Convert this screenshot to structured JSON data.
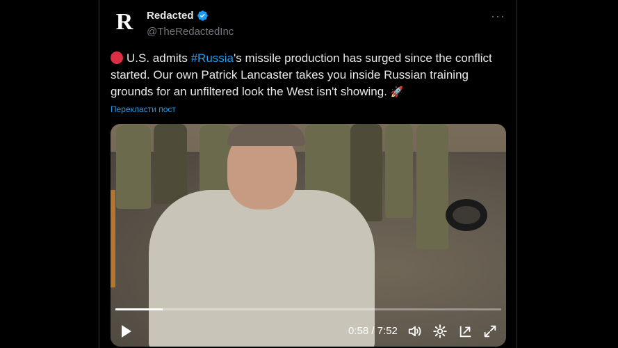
{
  "account": {
    "avatar_letter": "R",
    "display_name": "Redacted",
    "handle": "@TheRedactedInc",
    "verified_color": "#1d9bf0"
  },
  "tweet": {
    "text_before_hashtag": "U.S. admits ",
    "hashtag": "#Russia",
    "text_after_hashtag": "'s missile production has surged since the conflict started. Our own Patrick Lancaster takes you inside Russian training grounds for an unfiltered look the West isn't showing.",
    "rocket_emoji": "🚀",
    "translate_label": "Перекласти пост",
    "more_label": "···"
  },
  "video": {
    "current_time": "0:58",
    "duration": "7:52",
    "time_display": "0:58 / 7:52",
    "progress_fraction": 0.123
  },
  "colors": {
    "accent": "#1d9bf0",
    "background": "#000000",
    "text": "#e7e9ea",
    "muted": "#71767b"
  }
}
